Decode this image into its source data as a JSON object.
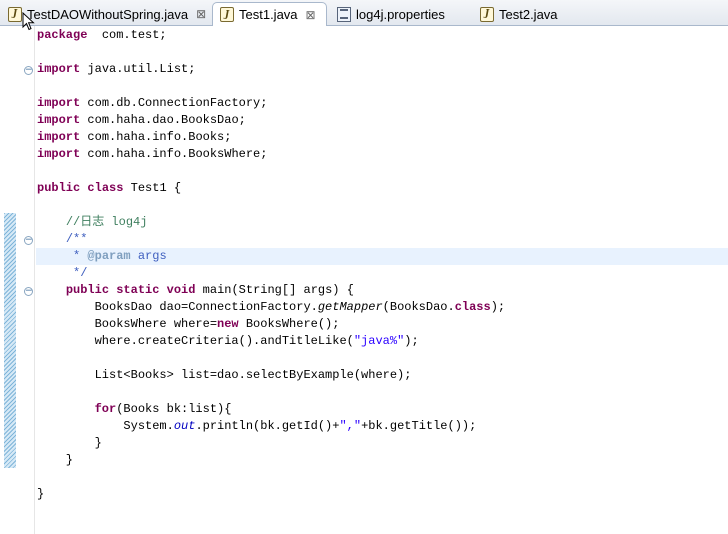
{
  "tabs": [
    {
      "label": "TestDAOWithoutSpring.java",
      "icon": "java-file-icon",
      "selected": false,
      "closable": true
    },
    {
      "label": "Test1.java",
      "icon": "java-file-icon",
      "selected": true,
      "closable": true
    },
    {
      "label": "log4j.properties",
      "icon": "properties-file-icon",
      "selected": false,
      "closable": false
    },
    {
      "label": "Test2.java",
      "icon": "java-file-icon",
      "selected": false,
      "closable": false
    }
  ],
  "tab_icon_glyph": "J",
  "close_glyph": "⊠",
  "fold_glyph": "−",
  "code_lines": [
    [
      [
        "kw",
        "package"
      ],
      [
        "",
        "  com.test;"
      ]
    ],
    [],
    [
      [
        "kw",
        "import"
      ],
      [
        "",
        " java.util.List;"
      ]
    ],
    [],
    [
      [
        "kw",
        "import"
      ],
      [
        "",
        " com.db.ConnectionFactory;"
      ]
    ],
    [
      [
        "kw",
        "import"
      ],
      [
        "",
        " com.haha.dao.BooksDao;"
      ]
    ],
    [
      [
        "kw",
        "import"
      ],
      [
        "",
        " com.haha.info.Books;"
      ]
    ],
    [
      [
        "kw",
        "import"
      ],
      [
        "",
        " com.haha.info.BooksWhere;"
      ]
    ],
    [],
    [
      [
        "kw",
        "public"
      ],
      [
        "",
        " "
      ],
      [
        "kw",
        "class"
      ],
      [
        "",
        " Test1 {"
      ]
    ],
    [],
    [
      [
        "",
        "    "
      ],
      [
        "cm",
        "//日志 log4j"
      ]
    ],
    [
      [
        "",
        "    "
      ],
      [
        "jd",
        "/**"
      ]
    ],
    [
      [
        "",
        "     "
      ],
      [
        "jd",
        "* "
      ],
      [
        "jt",
        "@param"
      ],
      [
        "jd",
        " args"
      ]
    ],
    [
      [
        "",
        "     "
      ],
      [
        "jd",
        "*/"
      ]
    ],
    [
      [
        "",
        "    "
      ],
      [
        "kw",
        "public"
      ],
      [
        "",
        " "
      ],
      [
        "kw",
        "static"
      ],
      [
        "",
        " "
      ],
      [
        "kw",
        "void"
      ],
      [
        "",
        " main(String[] args) {"
      ]
    ],
    [
      [
        "",
        "        BooksDao dao=ConnectionFactory."
      ],
      [
        "it",
        "getMapper"
      ],
      [
        "",
        "(BooksDao."
      ],
      [
        "kw",
        "class"
      ],
      [
        "",
        ");"
      ]
    ],
    [
      [
        "",
        "        BooksWhere where="
      ],
      [
        "kw",
        "new"
      ],
      [
        "",
        " BooksWhere();"
      ]
    ],
    [
      [
        "",
        "        where.createCriteria().andTitleLike("
      ],
      [
        "st",
        "\"java%\""
      ],
      [
        "",
        ");"
      ]
    ],
    [],
    [
      [
        "",
        "        List<Books> list=dao.selectByExample(where);"
      ]
    ],
    [],
    [
      [
        "",
        "        "
      ],
      [
        "kw",
        "for"
      ],
      [
        "",
        "(Books bk:list){"
      ]
    ],
    [
      [
        "",
        "            System."
      ],
      [
        "fld",
        "out"
      ],
      [
        "",
        ".println(bk.getId()+"
      ],
      [
        "st",
        "\",\""
      ],
      [
        "",
        "+bk.getTitle());"
      ]
    ],
    [
      [
        "",
        "        }"
      ]
    ],
    [
      [
        "",
        "    }"
      ]
    ],
    [],
    [
      [
        "",
        "}"
      ]
    ]
  ]
}
